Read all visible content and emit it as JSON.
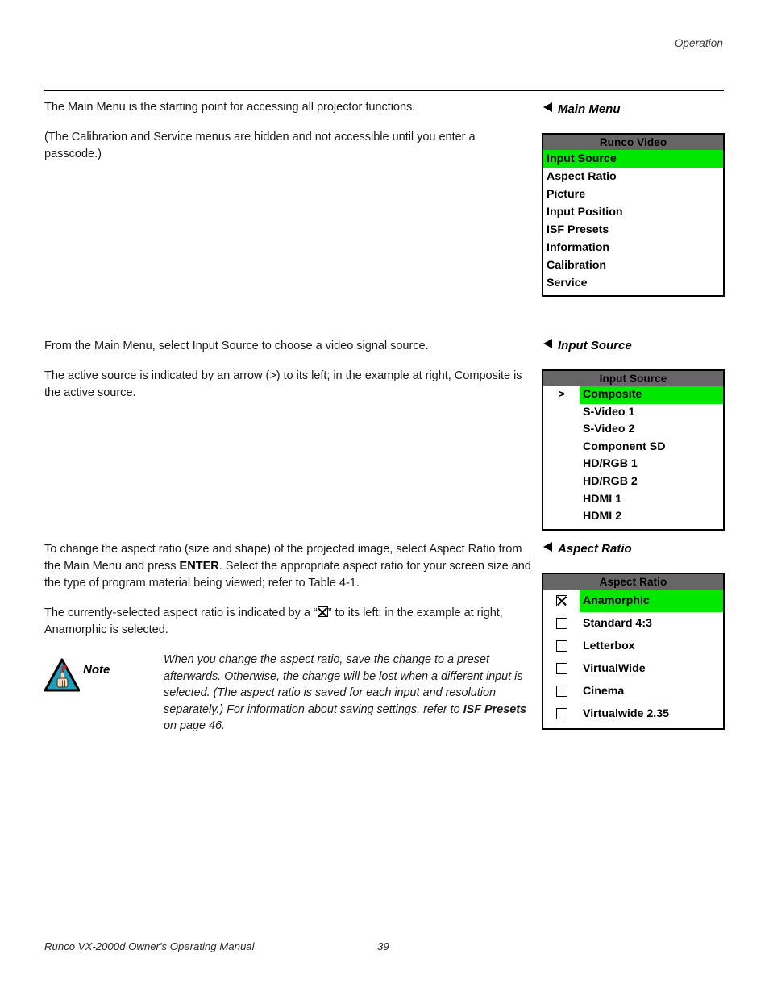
{
  "header": {
    "running_head": "Operation"
  },
  "footer": {
    "manual_title": "Runco VX-2000d Owner's Operating Manual",
    "page_number": "39"
  },
  "colors": {
    "osd_title_bar": "#666666",
    "osd_highlight": "#00e800",
    "osd_border": "#000000",
    "note_icon_fill": "#1f9fc0"
  },
  "sections": [
    {
      "heading": "Main Menu",
      "paragraphs": [
        "The Main Menu is the starting point for accessing all projector functions.",
        "(The Calibration and Service menus are hidden and not accessible until you enter a passcode.)"
      ]
    },
    {
      "heading": "Input Source",
      "paragraphs": [
        "From the Main Menu, select Input Source to choose a video signal source.",
        "The active source is indicated by an arrow (>) to its left; in the example at right, Composite is the active source."
      ]
    },
    {
      "heading": "Aspect Ratio",
      "paragraphs": [
        "To change the aspect ratio (size and shape) of the projected image, select Aspect Ratio from the Main Menu and press ENTER. Select the appropriate aspect ratio for your screen size and the type of program material being viewed; refer to Table 4-1.",
        "The currently-selected aspect ratio is indicated by a “⌧” to its left; in the example at right, Anamorphic is selected."
      ],
      "para3_pre": "To change the aspect ratio (size and shape) of the projected image, select Aspect Ratio from the Main Menu and press ",
      "para3_bold": "ENTER",
      "para3_post": ". Select the appropriate aspect ratio for your screen size and the type of program material being viewed; refer to Table 4-1.",
      "para4_pre": "The currently-selected aspect ratio is indicated by a “",
      "para4_post": "” to its left; in the example at right, Anamorphic is selected."
    }
  ],
  "note": {
    "label": "Note",
    "text_pre": "When you change the aspect ratio, save the change to a preset afterwards. Otherwise, the change will be lost when a different input is selected. (The aspect ratio is saved for each input and resolution separately.) For information about saving settings, refer to ",
    "text_bold": "ISF Presets",
    "text_post": " on page 46."
  },
  "menus": {
    "main": {
      "heading": "Main Menu",
      "title": "Runco Video",
      "items": [
        {
          "label": "Input Source",
          "highlighted": true
        },
        {
          "label": "Aspect Ratio",
          "highlighted": false
        },
        {
          "label": "Picture",
          "highlighted": false
        },
        {
          "label": "Input Position",
          "highlighted": false
        },
        {
          "label": "ISF Presets",
          "highlighted": false
        },
        {
          "label": "Information",
          "highlighted": false
        },
        {
          "label": "Calibration",
          "highlighted": false
        },
        {
          "label": "Service",
          "highlighted": false
        }
      ]
    },
    "input_source": {
      "heading": "Input Source",
      "title": "Input Source",
      "items": [
        {
          "label": "Composite",
          "marker": ">",
          "highlighted": true
        },
        {
          "label": "S-Video 1",
          "marker": "",
          "highlighted": false
        },
        {
          "label": "S-Video 2",
          "marker": "",
          "highlighted": false
        },
        {
          "label": "Component SD",
          "marker": "",
          "highlighted": false
        },
        {
          "label": "HD/RGB 1",
          "marker": "",
          "highlighted": false
        },
        {
          "label": "HD/RGB 2",
          "marker": "",
          "highlighted": false
        },
        {
          "label": "HDMI 1",
          "marker": "",
          "highlighted": false
        },
        {
          "label": "HDMI 2",
          "marker": "",
          "highlighted": false
        }
      ]
    },
    "aspect_ratio": {
      "heading": "Aspect Ratio",
      "title": "Aspect Ratio",
      "items": [
        {
          "label": "Anamorphic",
          "checked": true,
          "highlighted": true
        },
        {
          "label": "Standard 4:3",
          "checked": false,
          "highlighted": false
        },
        {
          "label": "Letterbox",
          "checked": false,
          "highlighted": false
        },
        {
          "label": "VirtualWide",
          "checked": false,
          "highlighted": false
        },
        {
          "label": "Cinema",
          "checked": false,
          "highlighted": false
        },
        {
          "label": "Virtualwide 2.35",
          "checked": false,
          "highlighted": false
        }
      ]
    }
  }
}
